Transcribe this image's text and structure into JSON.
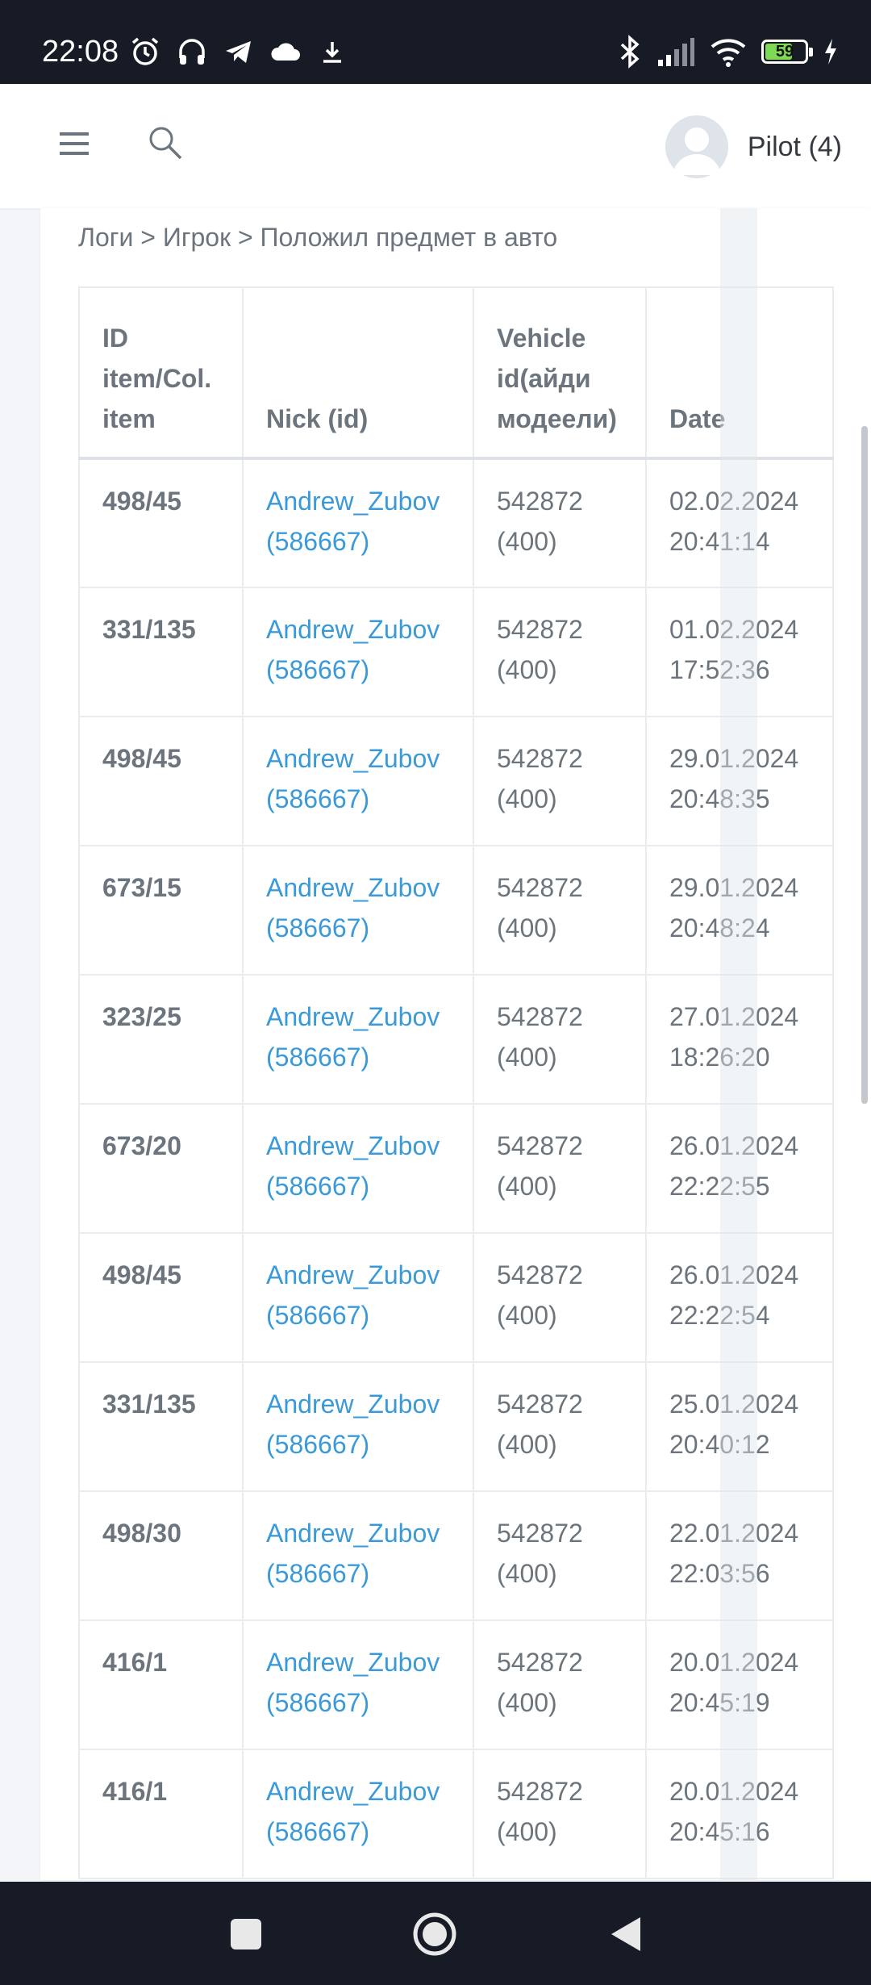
{
  "status_bar": {
    "time": "22:08",
    "battery_percent": "59",
    "icons_left": [
      "alarm-icon",
      "headphones-icon",
      "telegram-icon",
      "cloud-icon",
      "download-icon"
    ],
    "icons_right": [
      "bluetooth-icon",
      "signal-icon",
      "wifi-icon",
      "battery-icon",
      "charging-icon"
    ]
  },
  "header": {
    "user_name": "Pilot (4)",
    "menu_icon": "hamburger-menu-icon",
    "search_icon": "search-icon"
  },
  "breadcrumb": {
    "items": [
      "Логи",
      "Игрок",
      "Положил предмет в авто"
    ],
    "separator": ">"
  },
  "table": {
    "columns": [
      "ID item/Col. item",
      "Nick (id)",
      "Vehicle id(айди модеели)",
      "Date"
    ],
    "rows": [
      {
        "id": "498/45",
        "nick": "Andrew_Zubov",
        "nick_id": "(586667)",
        "vehicle": "542872",
        "model": "(400)",
        "date": "02.02.2024",
        "time": "20:41:14"
      },
      {
        "id": "331/135",
        "nick": "Andrew_Zubov",
        "nick_id": "(586667)",
        "vehicle": "542872",
        "model": "(400)",
        "date": "01.02.2024",
        "time": "17:52:36"
      },
      {
        "id": "498/45",
        "nick": "Andrew_Zubov",
        "nick_id": "(586667)",
        "vehicle": "542872",
        "model": "(400)",
        "date": "29.01.2024",
        "time": "20:48:35"
      },
      {
        "id": "673/15",
        "nick": "Andrew_Zubov",
        "nick_id": "(586667)",
        "vehicle": "542872",
        "model": "(400)",
        "date": "29.01.2024",
        "time": "20:48:24"
      },
      {
        "id": "323/25",
        "nick": "Andrew_Zubov",
        "nick_id": "(586667)",
        "vehicle": "542872",
        "model": "(400)",
        "date": "27.01.2024",
        "time": "18:26:20"
      },
      {
        "id": "673/20",
        "nick": "Andrew_Zubov",
        "nick_id": "(586667)",
        "vehicle": "542872",
        "model": "(400)",
        "date": "26.01.2024",
        "time": "22:22:55"
      },
      {
        "id": "498/45",
        "nick": "Andrew_Zubov",
        "nick_id": "(586667)",
        "vehicle": "542872",
        "model": "(400)",
        "date": "26.01.2024",
        "time": "22:22:54"
      },
      {
        "id": "331/135",
        "nick": "Andrew_Zubov",
        "nick_id": "(586667)",
        "vehicle": "542872",
        "model": "(400)",
        "date": "25.01.2024",
        "time": "20:40:12"
      },
      {
        "id": "498/30",
        "nick": "Andrew_Zubov",
        "nick_id": "(586667)",
        "vehicle": "542872",
        "model": "(400)",
        "date": "22.01.2024",
        "time": "22:03:56"
      },
      {
        "id": "416/1",
        "nick": "Andrew_Zubov",
        "nick_id": "(586667)",
        "vehicle": "542872",
        "model": "(400)",
        "date": "20.01.2024",
        "time": "20:45:19"
      },
      {
        "id": "416/1",
        "nick": "Andrew_Zubov",
        "nick_id": "(586667)",
        "vehicle": "542872",
        "model": "(400)",
        "date": "20.01.2024",
        "time": "20:45:16"
      }
    ]
  },
  "navbar": {
    "buttons": [
      "recents-square-icon",
      "home-circle-icon",
      "back-triangle-icon"
    ]
  },
  "colors": {
    "status_bar_bg": "#171b26",
    "link": "#3a9ad9",
    "text_muted": "#6c757d",
    "battery_fill": "#7ed957"
  }
}
